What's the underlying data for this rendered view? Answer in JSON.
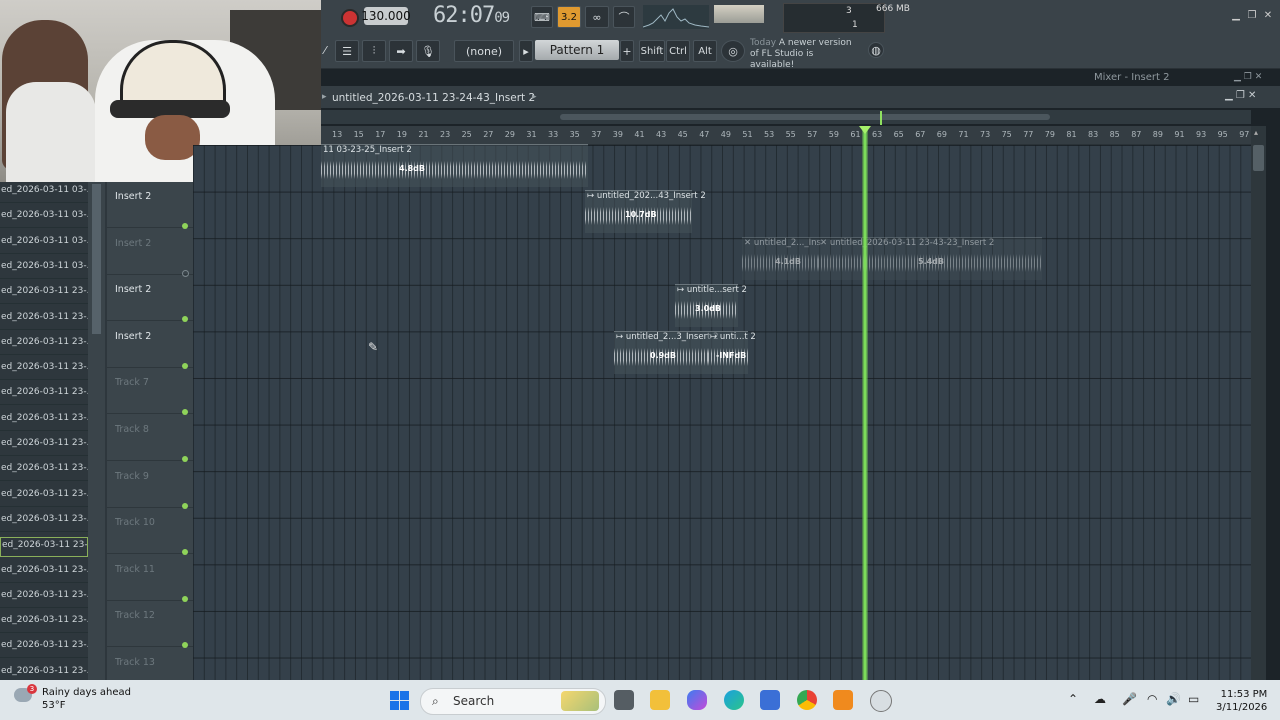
{
  "webcam": {
    "label": "webcam overlay"
  },
  "toolbar": {
    "tempo": "130.000",
    "time_main": "62:07",
    "time_sub": "09",
    "mode": "3.2",
    "cpu_value": "3",
    "memory": "666 MB",
    "voices": "1",
    "channel_none": "(none)",
    "pattern": "Pattern 1",
    "pattern_add": "+",
    "shift": "Shift",
    "ctrl": "Ctrl",
    "alt": "Alt",
    "hint_today": "Today",
    "hint_text": "A newer version of FL Studio is available!"
  },
  "mixer": {
    "title": "Mixer - Insert 2"
  },
  "playlist": {
    "title": "untitled_2026-03-11 23-24-43_Insert 2",
    "ruler_ticks": [
      "13",
      "15",
      "17",
      "19",
      "21",
      "23",
      "25",
      "27",
      "29",
      "31",
      "33",
      "35",
      "37",
      "39",
      "41",
      "43",
      "45",
      "47",
      "49",
      "51",
      "53",
      "55",
      "57",
      "59",
      "61",
      "63",
      "65",
      "67",
      "69",
      "71",
      "73",
      "75",
      "77",
      "79",
      "81",
      "83",
      "85",
      "87",
      "89",
      "91",
      "93",
      "95",
      "97"
    ]
  },
  "browser": {
    "items": [
      "ed_2026-03-11 03-...",
      "ed_2026-03-11 03-...",
      "ed_2026-03-11 03-...",
      "ed_2026-03-11 03-...",
      "ed_2026-03-11 23-...",
      "ed_2026-03-11 23-...",
      "ed_2026-03-11 23-...",
      "ed_2026-03-11 23-...",
      "ed_2026-03-11 23-...",
      "ed_2026-03-11 23-...",
      "ed_2026-03-11 23-...",
      "ed_2026-03-11 23-...",
      "ed_2026-03-11 23-...",
      "ed_2026-03-11 23-...",
      "ed_2026-03-11 23-...",
      "ed_2026-03-11 23-...",
      "ed_2026-03-11 23-...",
      "ed_2026-03-11 23-...",
      "ed_2026-03-11 23-...",
      "ed_2026-03-11 23-..."
    ]
  },
  "tracks": [
    {
      "name": "Insert 2",
      "dim": false
    },
    {
      "name": "Insert 2",
      "dim": true
    },
    {
      "name": "Insert 2",
      "dim": false
    },
    {
      "name": "Insert 2",
      "dim": false
    },
    {
      "name": "Track 7",
      "dim": true
    },
    {
      "name": "Track 8",
      "dim": true
    },
    {
      "name": "Track 9",
      "dim": true
    },
    {
      "name": "Track 10",
      "dim": true
    },
    {
      "name": "Track 11",
      "dim": true
    },
    {
      "name": "Track 12",
      "dim": true
    },
    {
      "name": "Track 13",
      "dim": true
    }
  ],
  "clips": [
    {
      "title": "11 03-23-25_Insert 2",
      "db": "4.8dB"
    },
    {
      "title": "↦ untitled_202...43_Insert 2",
      "db": "10.7dB"
    },
    {
      "title": "✕ untitled_2..._Ins",
      "db": "4.1dB"
    },
    {
      "title": "✕ untitled_2026-03-11 23-43-23_Insert 2",
      "db": "5.4dB"
    },
    {
      "title": "↦ untitle...sert 2",
      "db": "3.0dB"
    },
    {
      "title": "↦ untitled_2...3_Insert 2",
      "db": "0.9dB"
    },
    {
      "title": "↦ unti...t 2",
      "db": "-INFdB"
    }
  ],
  "taskbar": {
    "weather_title": "Rainy days ahead",
    "weather_temp": "53°F",
    "weather_badge": "3",
    "search": "Search",
    "time": "11:53 PM",
    "date": "3/11/2026"
  }
}
